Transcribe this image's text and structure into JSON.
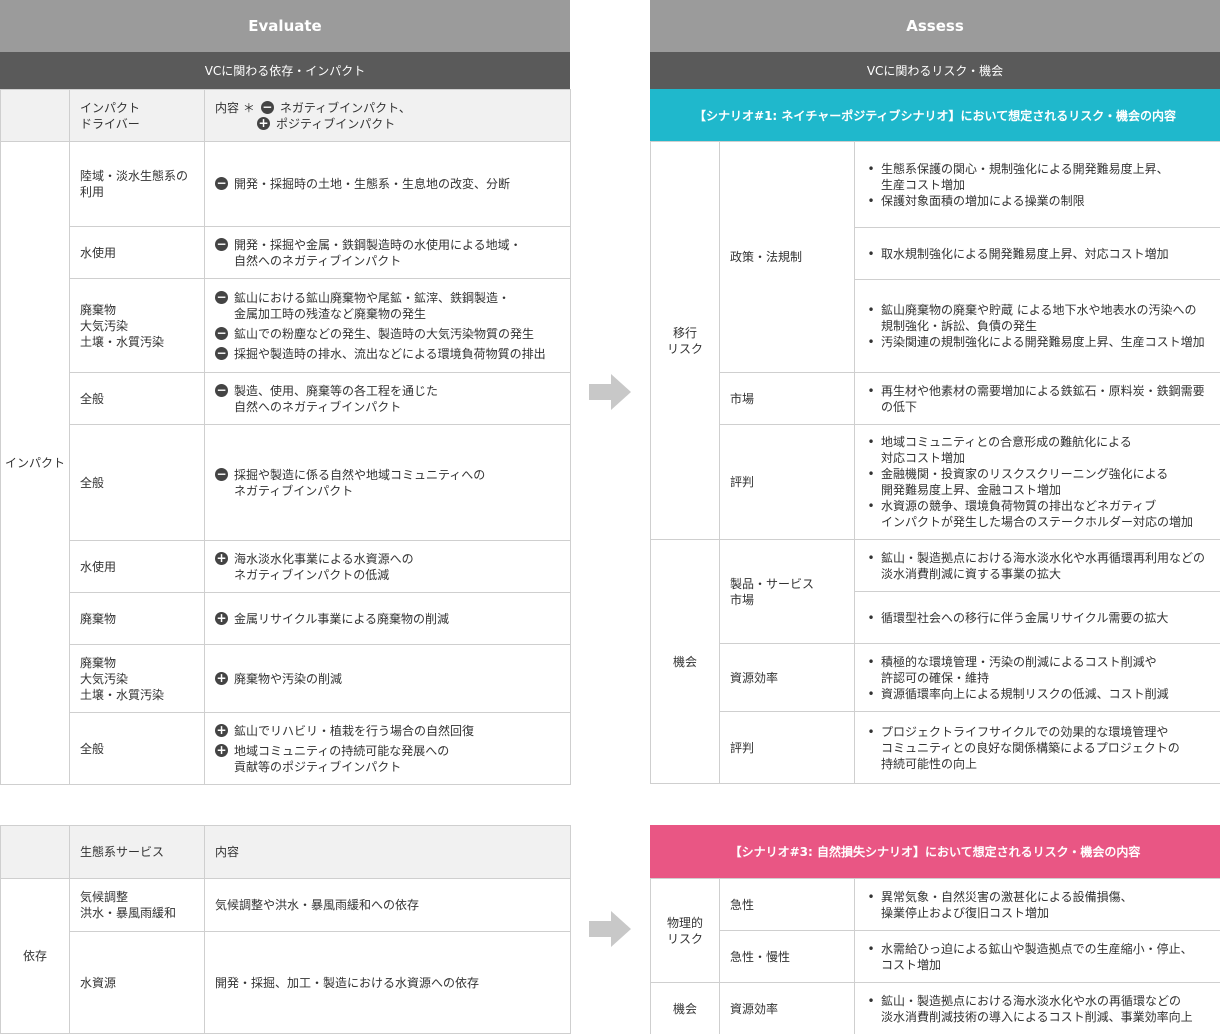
{
  "evaluate": {
    "title": "Evaluate",
    "subtitle": "VCに関わる依存・インパクト",
    "header": {
      "col2": "インパクト\nドライバー",
      "col3_prefix": "内容 ＊",
      "neg_label": "ネガティブインパクト、",
      "pos_label": "ポジティブインパクト"
    },
    "group_label": "インパクト",
    "rows": [
      {
        "driver": "陸域・淡水生態系の\n利用",
        "items": [
          {
            "sign": "−",
            "text": "開発・採掘時の土地・生態系・生息地の改変、分断"
          }
        ]
      },
      {
        "driver": "水使用",
        "items": [
          {
            "sign": "−",
            "text": "開発・採掘や金属・鉄鋼製造時の水使用による地域・\n自然へのネガティブインパクト"
          }
        ]
      },
      {
        "driver": "廃棄物\n大気汚染\n土壌・水質汚染",
        "items": [
          {
            "sign": "−",
            "text": "鉱山における鉱山廃棄物や尾鉱・鉱滓、鉄鋼製造・\n金属加工時の残渣など廃棄物の発生"
          },
          {
            "sign": "−",
            "text": "鉱山での粉塵などの発生、製造時の大気汚染物質の発生"
          },
          {
            "sign": "−",
            "text": "採掘や製造時の排水、流出などによる環境負荷物質の排出"
          }
        ]
      },
      {
        "driver": "全般",
        "items": [
          {
            "sign": "−",
            "text": "製造、使用、廃棄等の各工程を通じた\n自然へのネガティブインパクト"
          }
        ]
      },
      {
        "driver": "全般",
        "items": [
          {
            "sign": "−",
            "text": "採掘や製造に係る自然や地域コミュニティへの\nネガティブインパクト"
          }
        ]
      },
      {
        "driver": "水使用",
        "items": [
          {
            "sign": "+",
            "text": "海水淡水化事業による水資源への\nネガティブインパクトの低減"
          }
        ]
      },
      {
        "driver": "廃棄物",
        "items": [
          {
            "sign": "+",
            "text": "金属リサイクル事業による廃棄物の削減"
          }
        ]
      },
      {
        "driver": "廃棄物\n大気汚染\n土壌・水質汚染",
        "items": [
          {
            "sign": "+",
            "text": "廃棄物や汚染の削減"
          }
        ]
      },
      {
        "driver": "全般",
        "items": [
          {
            "sign": "+",
            "text": "鉱山でリハビリ・植栽を行う場合の自然回復"
          },
          {
            "sign": "+",
            "text": "地域コミュニティの持続可能な発展への\n貢献等のポジティブインパクト"
          }
        ]
      }
    ]
  },
  "dependency": {
    "header": {
      "col2": "生態系サービス",
      "col3": "内容"
    },
    "group_label": "依存",
    "rows": [
      {
        "service": "気候調整\n洪水・暴風雨緩和",
        "content": "気候調整や洪水・暴風雨緩和への依存"
      },
      {
        "service": "水資源",
        "content": "開発・採掘、加工・製造における水資源への依存"
      }
    ]
  },
  "assess": {
    "title": "Assess",
    "subtitle": "VCに関わるリスク・機会",
    "scenario1": "【シナリオ#1: ネイチャーポジティブシナリオ】において想定されるリスク・機会の内容",
    "transition_label": "移行\nリスク",
    "opportunity_label": "機会",
    "policy_label": "政策・法規制",
    "market_label": "市場",
    "reputation_label": "評判",
    "product_label": "製品・サービス\n市場",
    "efficiency_label": "資源効率",
    "reputation2_label": "評判",
    "policy_rows": [
      [
        "生態系保護の関心・規制強化による開発難易度上昇、\n生産コスト増加",
        "保護対象面積の増加による操業の制限"
      ],
      [
        "取水規制強化による開発難易度上昇、対応コスト増加"
      ],
      [
        "鉱山廃棄物の廃棄や貯蔵 による地下水や地表水の汚染への\n規制強化・訴訟、負債の発生",
        "汚染関連の規制強化による開発難易度上昇、生産コスト増加"
      ]
    ],
    "market_rows": [
      [
        "再生材や他素材の需要増加による鉄鉱石・原料炭・鉄鋼需要\nの低下"
      ]
    ],
    "reputation_rows": [
      [
        "地域コミュニティとの合意形成の難航化による\n対応コスト増加",
        "金融機関・投資家のリスクスクリーニング強化による\n開発難易度上昇、金融コスト増加",
        "水資源の競争、環境負荷物質の排出などネガティブ\nインパクトが発生した場合のステークホルダー対応の増加"
      ]
    ],
    "product_rows": [
      [
        "鉱山・製造拠点における海水淡水化や水再循環再利用などの\n淡水消費削減に資する事業の拡大"
      ],
      [
        "循環型社会への移行に伴う金属リサイクル需要の拡大"
      ]
    ],
    "efficiency_rows": [
      [
        "積極的な環境管理・汚染の削減によるコスト削減や\n許認可の確保・維持",
        "資源循環率向上による規制リスクの低減、コスト削減"
      ]
    ],
    "reputation2_rows": [
      [
        "プロジェクトライフサイクルでの効果的な環境管理や\nコミュニティとの良好な関係構築によるプロジェクトの\n持続可能性の向上"
      ]
    ],
    "scenario3": "【シナリオ#3: 自然損失シナリオ】において想定されるリスク・機会の内容",
    "physical_label": "物理的\nリスク",
    "acute_label": "急性",
    "chronic_label": "急性・慢性",
    "opportunity3_label": "機会",
    "efficiency3_label": "資源効率",
    "acute_rows": [
      [
        "異常気象・自然災害の激甚化による設備損傷、\n操業停止および復旧コスト増加"
      ]
    ],
    "chronic_rows": [
      [
        "水需給ひっ迫による鉱山や製造拠点での生産縮小・停止、\nコスト増加"
      ]
    ],
    "efficiency3_rows": [
      [
        "鉱山・製造拠点における海水淡水化や水の再循環などの\n淡水消費削減技術の導入によるコスト削減、事業効率向上"
      ]
    ]
  }
}
